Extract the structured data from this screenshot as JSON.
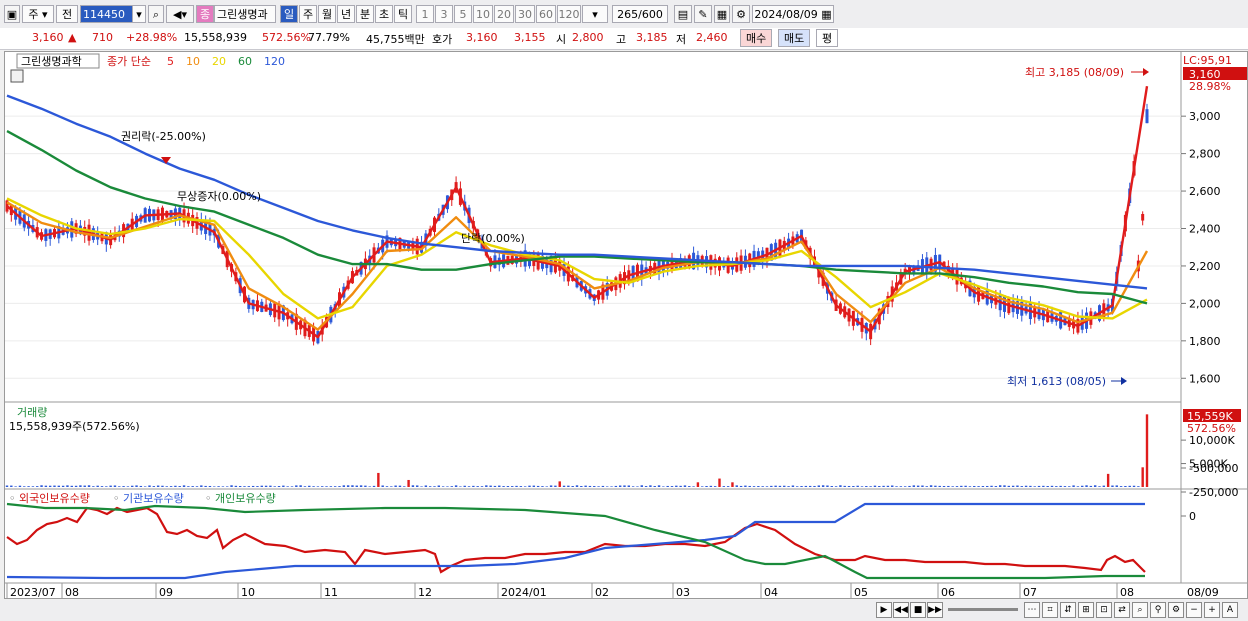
{
  "toolbar": {
    "market_type": "주",
    "market_all": "전",
    "code": "114450",
    "stock_name": "그린생명과",
    "periods": [
      "일",
      "주",
      "월",
      "년",
      "분",
      "초",
      "틱"
    ],
    "active_period": "일",
    "intervals": [
      "1",
      "3",
      "5",
      "10",
      "20",
      "30",
      "60",
      "120"
    ],
    "count": "265",
    "count_total": "/600",
    "date": "2024/08/09"
  },
  "quote": {
    "price": "3,160",
    "change": "710",
    "change_pct": "+28.98%",
    "volume": "15,558,939",
    "volume_pct": "572.56%",
    "turnover": "77.79%",
    "amount": "45,755백만",
    "hoga_label": "호가",
    "ask": "3,160",
    "bid": "3,155",
    "open_label": "시",
    "open": "2,800",
    "high_label": "고",
    "high": "3,185",
    "low_label": "저",
    "low": "2,460",
    "buy_btn": "매수",
    "sell_btn": "매도",
    "eval_btn": "평"
  },
  "legend": {
    "name": "그린생명과학",
    "ma_label": "종가 단순",
    "ma_periods": [
      {
        "label": "5",
        "color": "#e01c1c"
      },
      {
        "label": "10",
        "color": "#f08c10"
      },
      {
        "label": "20",
        "color": "#e8d600"
      },
      {
        "label": "60",
        "color": "#1a8a3a"
      },
      {
        "label": "120",
        "color": "#2c58d8"
      }
    ],
    "lc_label": "LC:95,91",
    "current_tag": "3,160",
    "current_pct": "28.98%"
  },
  "annotations": {
    "high": "최고 3,185 (08/09)",
    "low": "최저 1,613 (08/05)",
    "event1": "권리락(-25.00%)",
    "event2": "무상증자(0.00%)",
    "event3": "단락(0.00%)"
  },
  "volume_panel": {
    "title": "거래량",
    "value": "15,558,939주(572.56%)",
    "tag": "15,559K",
    "tag_pct": "572.56%"
  },
  "holding_panel": {
    "labels": [
      {
        "label": "외국인보유수량",
        "color": "#d01010"
      },
      {
        "label": "기관보유수량",
        "color": "#2c58d8"
      },
      {
        "label": "개인보유수량",
        "color": "#1a8a3a"
      }
    ]
  },
  "x_axis": [
    "2023/07",
    "08",
    "09",
    "10",
    "11",
    "12",
    "2024/01",
    "02",
    "03",
    "04",
    "05",
    "06",
    "07",
    "08"
  ],
  "x_axis_right": "08/09",
  "price_axis": [
    "3,000",
    "2,800",
    "2,600",
    "2,400",
    "2,200",
    "2,000",
    "1,800",
    "1,600"
  ],
  "volume_axis": [
    "10,000K",
    "5,000K"
  ],
  "holding_axis": [
    "0",
    "-250,000",
    "-500,000"
  ],
  "chart_data": {
    "type": "line",
    "title": "",
    "x_labels": [
      "2023/07",
      "08",
      "09",
      "10",
      "11",
      "12",
      "2024/01",
      "02",
      "03",
      "04",
      "05",
      "06",
      "07",
      "08"
    ],
    "ylim": [
      1500,
      3300
    ],
    "series": [
      {
        "name": "5",
        "color": "#e01c1c",
        "values": [
          2520,
          2360,
          2400,
          2340,
          2470,
          2480,
          2380,
          2000,
          1950,
          1820,
          2140,
          2330,
          2300,
          2620,
          2220,
          2240,
          2200,
          2030,
          2150,
          2200,
          2230,
          2200,
          2260,
          2360,
          1990,
          1850,
          2170,
          2220,
          2060,
          1990,
          1940,
          1880,
          1990,
          3160
        ]
      },
      {
        "name": "10",
        "color": "#f08c10",
        "values": [
          2540,
          2430,
          2380,
          2350,
          2410,
          2470,
          2420,
          2080,
          1980,
          1860,
          2050,
          2280,
          2290,
          2460,
          2280,
          2250,
          2210,
          2080,
          2120,
          2190,
          2220,
          2210,
          2240,
          2330,
          2050,
          1900,
          2110,
          2190,
          2080,
          2010,
          1970,
          1900,
          1950,
          2280
        ]
      },
      {
        "name": "20",
        "color": "#e8d600",
        "values": [
          2560,
          2470,
          2400,
          2370,
          2400,
          2450,
          2440,
          2260,
          2050,
          1920,
          1980,
          2200,
          2260,
          2380,
          2310,
          2260,
          2230,
          2130,
          2110,
          2170,
          2200,
          2210,
          2230,
          2280,
          2140,
          1980,
          2060,
          2160,
          2100,
          2030,
          1990,
          1930,
          1920,
          2020
        ]
      },
      {
        "name": "60",
        "color": "#1a8a3a",
        "values": [
          2920,
          2820,
          2710,
          2620,
          2560,
          2520,
          2490,
          2420,
          2350,
          2260,
          2210,
          2210,
          2180,
          2180,
          2210,
          2230,
          2250,
          2250,
          2240,
          2230,
          2220,
          2220,
          2210,
          2200,
          2180,
          2170,
          2160,
          2160,
          2140,
          2110,
          2090,
          2060,
          2050,
          2000
        ]
      },
      {
        "name": "120",
        "color": "#2c58d8",
        "values": [
          3110,
          3040,
          2960,
          2890,
          2800,
          2720,
          2660,
          2580,
          2510,
          2440,
          2390,
          2350,
          2320,
          2300,
          2280,
          2270,
          2260,
          2260,
          2250,
          2240,
          2230,
          2220,
          2210,
          2200,
          2200,
          2200,
          2200,
          2190,
          2180,
          2160,
          2140,
          2120,
          2100,
          2080
        ]
      }
    ]
  }
}
